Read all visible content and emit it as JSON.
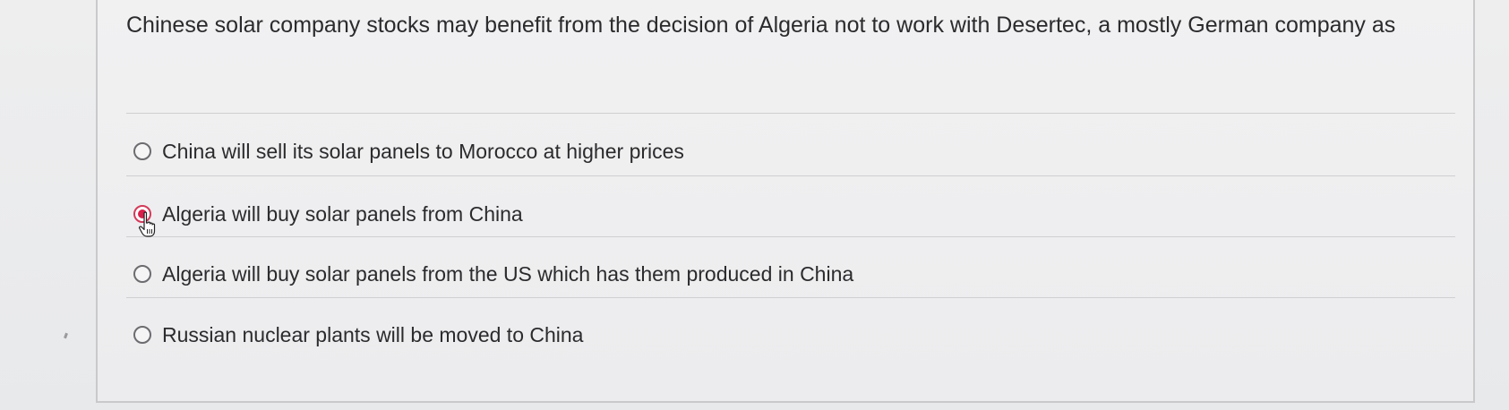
{
  "question": {
    "prompt": "Chinese solar company stocks may benefit from the decision of Algeria not to work with Desertec, a mostly German company as",
    "options": [
      {
        "label": "China will sell its solar panels to Morocco at higher prices",
        "selected": false
      },
      {
        "label": "Algeria will buy solar panels from China",
        "selected": true
      },
      {
        "label": "Algeria will buy solar panels from the US which has them produced in China",
        "selected": false
      },
      {
        "label": "Russian nuclear plants will be moved to China",
        "selected": false
      }
    ]
  },
  "colors": {
    "selected_radio": "#d8204a",
    "text": "#2b2b2d",
    "rule": "#cfcfd2"
  },
  "icons": {
    "cursor": "hand-pointer-icon",
    "radio": "radio-button-icon"
  }
}
